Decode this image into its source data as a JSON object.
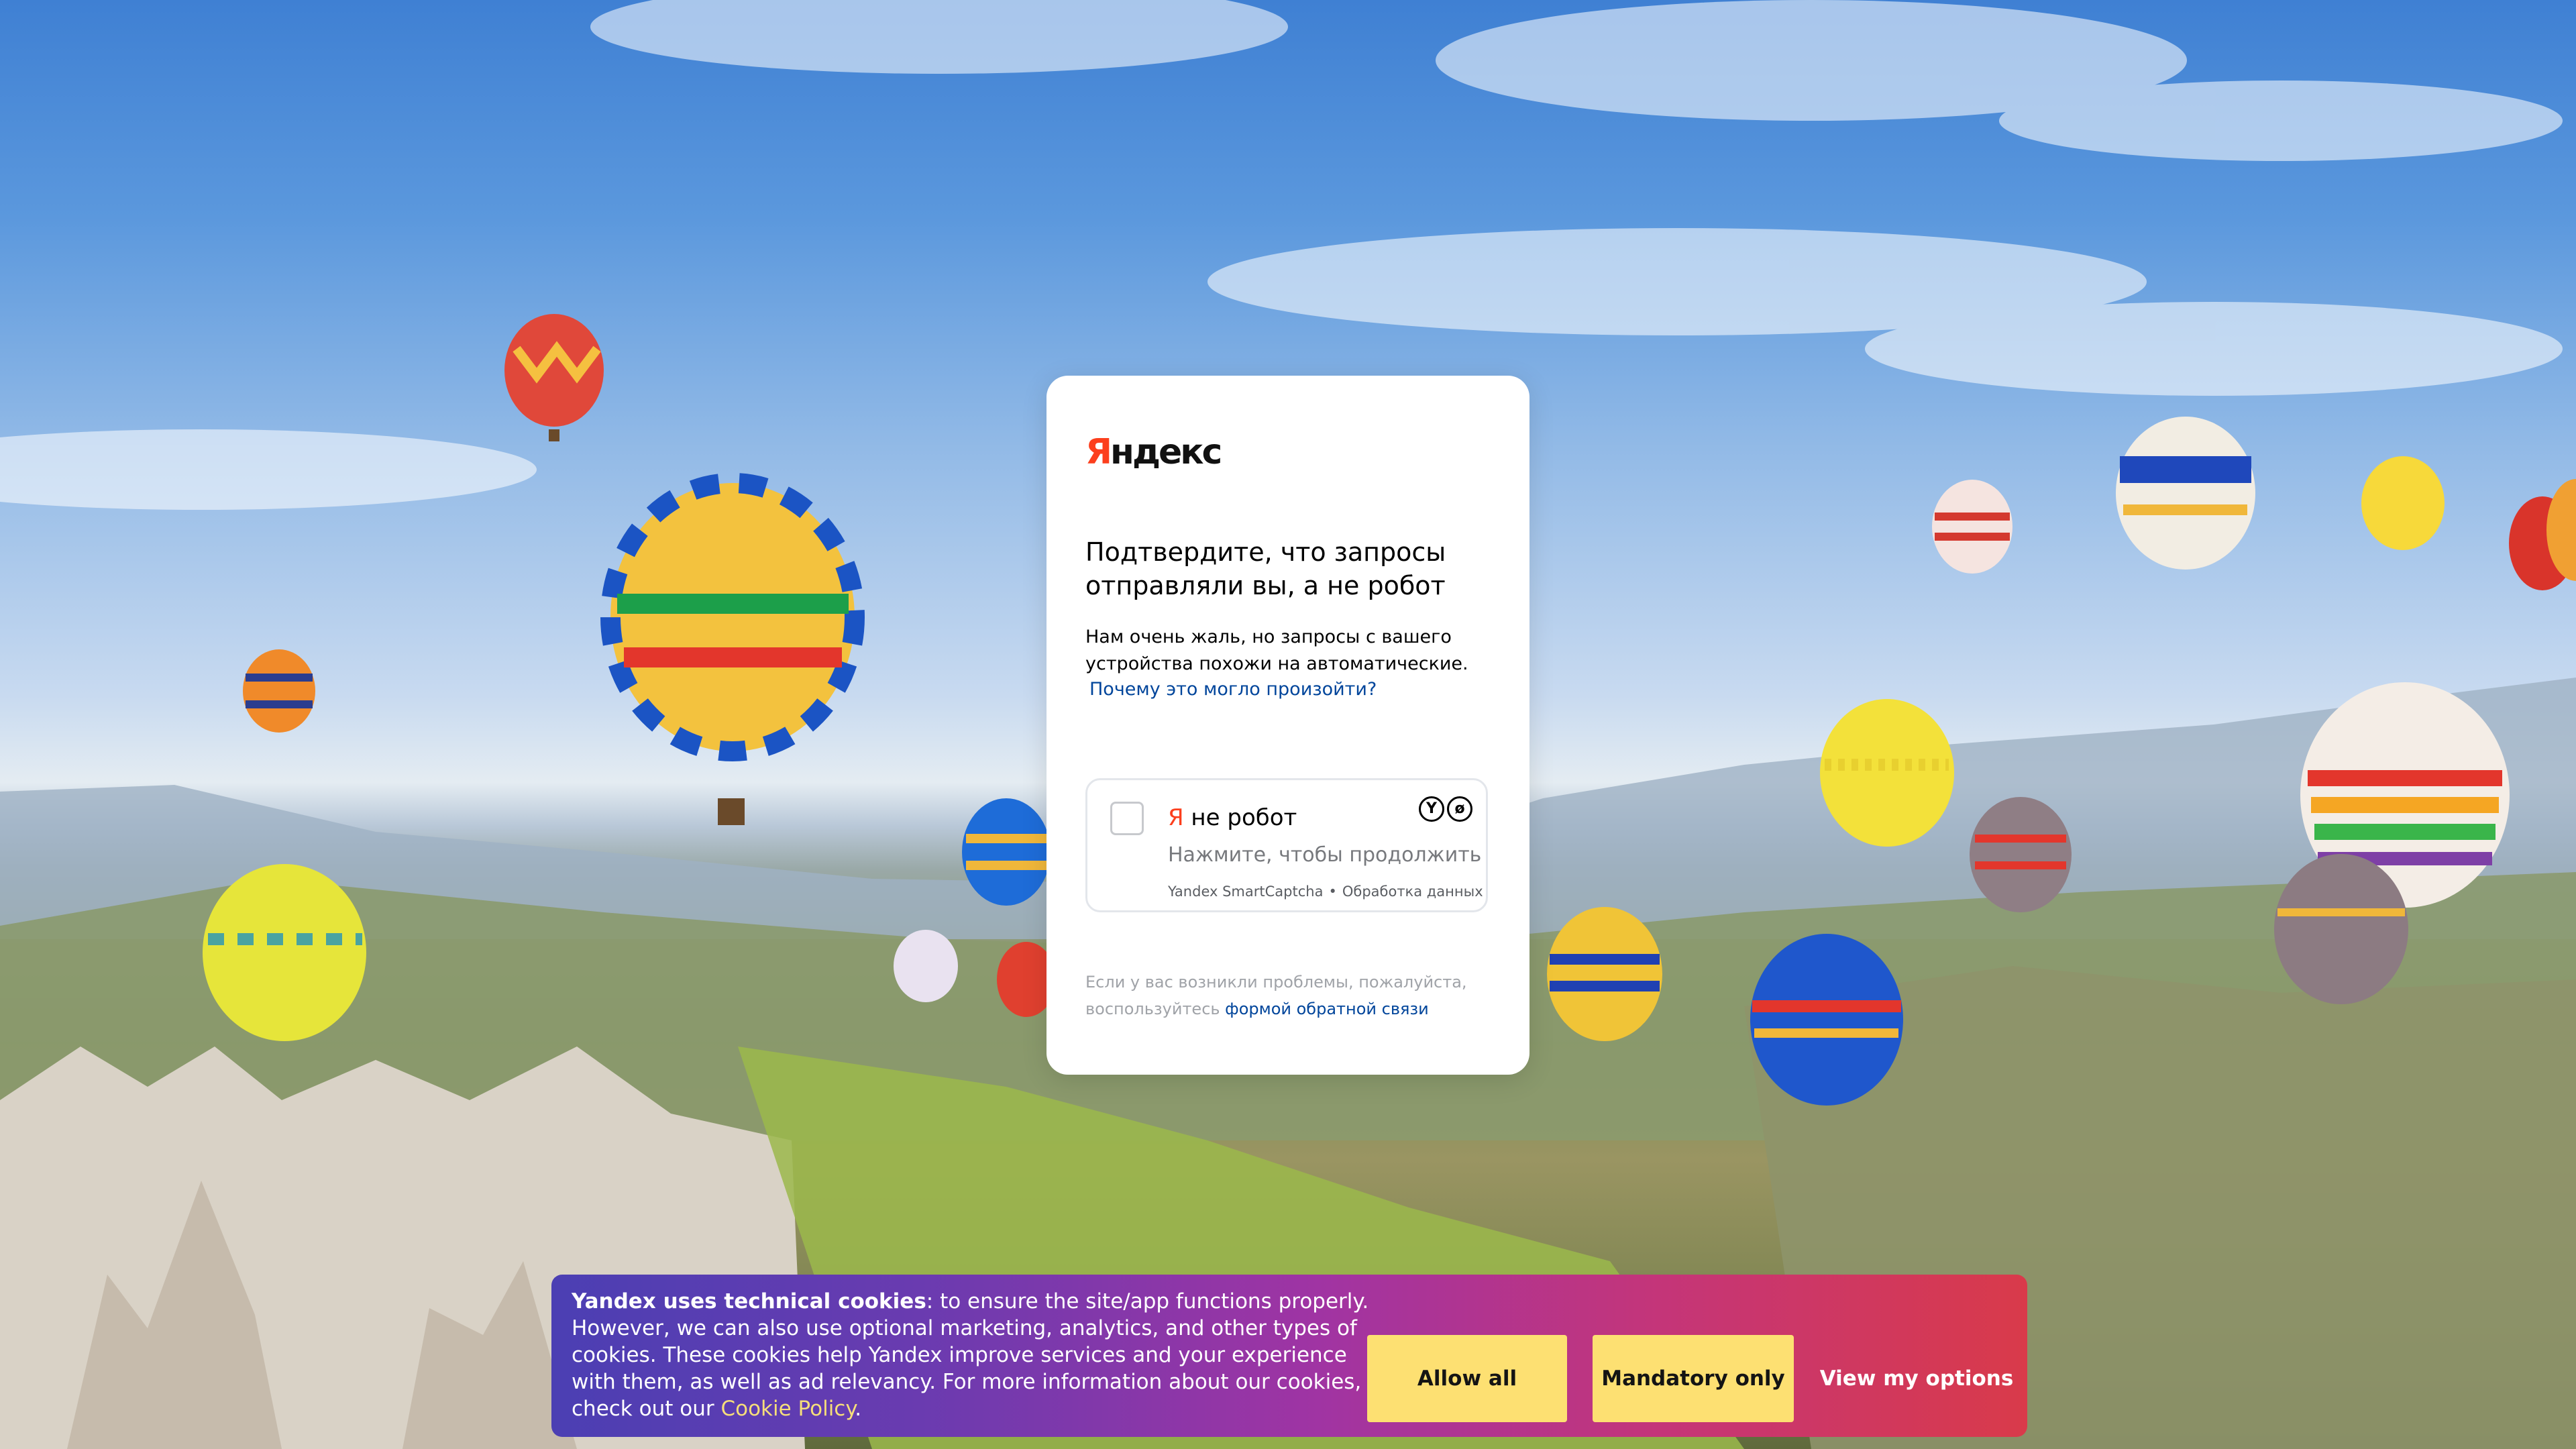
{
  "page": {
    "background_image": "hot-air-balloons-cappadocia"
  },
  "captcha_card": {
    "logo_first_letter": "Я",
    "logo_rest": "ндекс",
    "title": "Подтвердите, что запросы отправляли вы, а не робот",
    "description": "Нам очень жаль, но запросы с вашего устройства похожи на автоматические.",
    "why_link": "Почему это могло произойти?",
    "checkbox": {
      "label_prefix": "Я",
      "label_rest": " не робот",
      "hint": "Нажмите, чтобы продолжить",
      "footer_brand": "Yandex SmartCaptcha",
      "footer_separator": "•",
      "footer_data_link": "Обработка данных",
      "icons": [
        "yandex-y-icon",
        "smartcaptcha-icon"
      ]
    },
    "help_text_prefix": "Если у вас возникли проблемы, пожалуйста, воспользуйтесь",
    "help_link": "формой обратной связи"
  },
  "cookie_banner": {
    "bold_intro": "Yandex uses technical cookies",
    "text": ": to ensure the site/app functions properly. However, we can also use optional marketing, analytics, and other types of cookies. These cookies help Yandex improve services and your experience with them, as well as ad relevancy. For more information about our cookies, check out our ",
    "policy_link": "Cookie Policy",
    "text_end": ".",
    "buttons": {
      "allow_all": "Allow all",
      "mandatory_only": "Mandatory only",
      "view_options": "View my options"
    },
    "colors": {
      "gradient_start": "#4b3fb3",
      "gradient_end": "#d93a4a",
      "button_yellow": "#fde072",
      "link_yellow": "#f6de7a"
    }
  },
  "colors": {
    "yandex_red": "#fc3f1d",
    "link_blue": "#00459b"
  }
}
